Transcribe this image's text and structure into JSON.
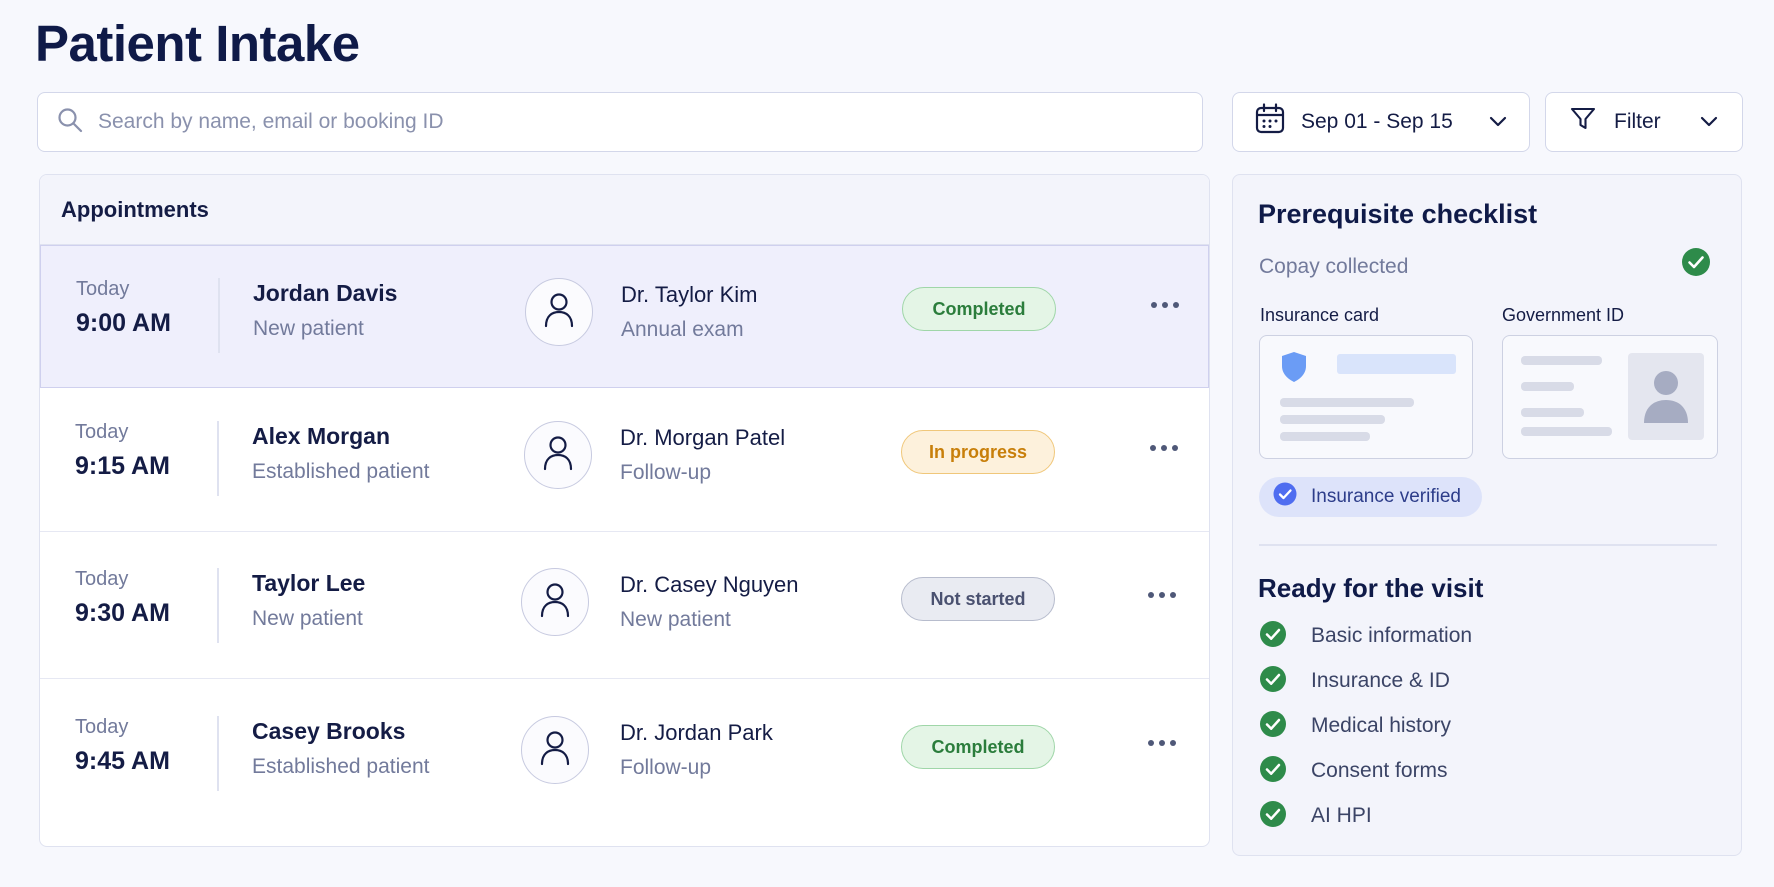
{
  "page": {
    "title": "Patient Intake"
  },
  "search": {
    "placeholder": "Search by name, email or booking ID",
    "icon": "search-icon"
  },
  "date_range": {
    "label": "Sep 01 - Sep 15",
    "icon": "calendar-icon"
  },
  "filter": {
    "label": "Filter",
    "icon": "filter-icon"
  },
  "appointments": {
    "heading": "Appointments",
    "rows": [
      {
        "day": "Today",
        "time": "9:00 AM",
        "patient": "Jordan Davis",
        "patient_type": "New patient",
        "doctor": "Dr. Taylor Kim",
        "visit": "Annual exam",
        "status": "Completed",
        "status_kind": "completed",
        "selected": true
      },
      {
        "day": "Today",
        "time": "9:15 AM",
        "patient": "Alex Morgan",
        "patient_type": "Established patient",
        "doctor": "Dr. Morgan Patel",
        "visit": "Follow-up",
        "status": "In progress",
        "status_kind": "in-progress",
        "selected": false
      },
      {
        "day": "Today",
        "time": "9:30 AM",
        "patient": "Taylor Lee",
        "patient_type": "New patient",
        "doctor": "Dr. Casey Nguyen",
        "visit": "New patient",
        "status": "Not started",
        "status_kind": "not-started",
        "selected": false
      },
      {
        "day": "Today",
        "time": "9:45 AM",
        "patient": "Casey Brooks",
        "patient_type": "Established patient",
        "doctor": "Dr. Jordan Park",
        "visit": "Follow-up",
        "status": "Completed",
        "status_kind": "completed",
        "selected": false
      }
    ]
  },
  "checklist": {
    "title": "Prerequisite checklist",
    "copay": "Copay collected",
    "insurance_card_label": "Insurance card",
    "government_id_label": "Government ID",
    "insurance_verified": "Insurance verified",
    "ready_title": "Ready for the visit",
    "ready_items": [
      "Basic information",
      "Insurance & ID",
      "Medical history",
      "Consent forms",
      "AI HPI"
    ]
  },
  "colors": {
    "accent": "#4f6df0",
    "success": "#2e8b4a",
    "completed_badge_bg": "#e4f5e6",
    "in_progress_badge_bg": "#fdf1dc",
    "not_started_badge_bg": "#e9ebf2",
    "selected_row_bg": "#efeffc"
  }
}
